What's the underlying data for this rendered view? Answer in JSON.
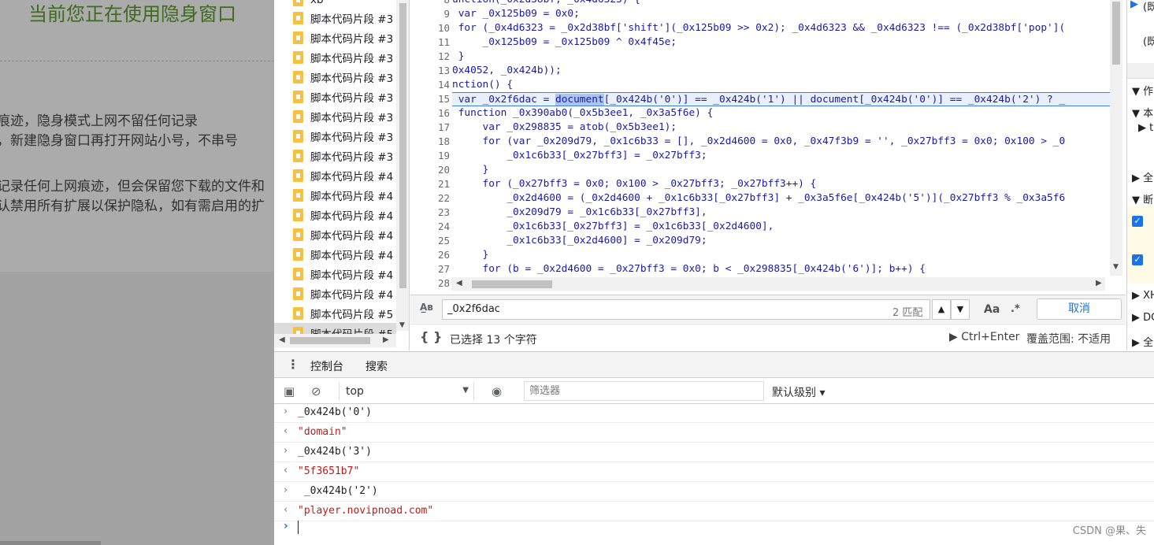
{
  "page": {
    "title": "当前您正在使用隐身窗口",
    "lines": [
      ":",
      "痕迹，隐身模式上网不留任何记录",
      "，新建隐身窗口再打开网站小号，不串号",
      "记录任何上网痕迹，但会保留您下载的文件和",
      "认禁用所有扩展以保护隐私，如有需启用的扩"
    ]
  },
  "navigator": {
    "top_label": "xb",
    "items": [
      "脚本代码片段 #3",
      "脚本代码片段 #3",
      "脚本代码片段 #3",
      "脚本代码片段 #3",
      "脚本代码片段 #3",
      "脚本代码片段 #3",
      "脚本代码片段 #3",
      "脚本代码片段 #3",
      "脚本代码片段 #4",
      "脚本代码片段 #4",
      "脚本代码片段 #4",
      "脚本代码片段 #4",
      "脚本代码片段 #4",
      "脚本代码片段 #4",
      "脚本代码片段 #4",
      "脚本代码片段 #5",
      "脚本代码片段 #5"
    ]
  },
  "editor": {
    "line_numbers": [
      "8",
      "9",
      "10",
      "11",
      "12",
      "13",
      "14",
      "15",
      "16",
      "17",
      "18",
      "19",
      "20",
      "21",
      "22",
      "23",
      "24",
      "25",
      "26",
      "27",
      "28"
    ],
    "lines": [
      "unction(_0x2d38bf, _0x4d6323) {",
      " var _0x125b09 = 0x0;",
      " for (_0x4d6323 = _0x2d38bf['shift'](_0x125b09 >> 0x2); _0x4d6323 && _0x4d6323 !== (_0x2d38bf['pop'](",
      "     _0x125b09 = _0x125b09 ^ 0x4f45e;",
      " }",
      "0x4052, _0x424b));",
      "nction() {",
      " var _0x2f6dac = ",
      " function _0x390ab0(_0x5b3ee1, _0x3a5f6e) {",
      "     var _0x298835 = atob(_0x5b3ee1);",
      "     for (var _0x209d79, _0x1c6b33 = [], _0x2d4600 = 0x0, _0x47f3b9 = '', _0x27bff3 = 0x0; 0x100 > _0",
      "         _0x1c6b33[_0x27bff3] = _0x27bff3;",
      "     }",
      "     for (_0x27bff3 = 0x0; 0x100 > _0x27bff3; _0x27bff3++) {",
      "         _0x2d4600 = (_0x2d4600 + _0x1c6b33[_0x27bff3] + _0x3a5f6e[_0x424b('5')](_0x27bff3 % _0x3a5f6",
      "         _0x209d79 = _0x1c6b33[_0x27bff3],",
      "         _0x1c6b33[_0x27bff3] = _0x1c6b33[_0x2d4600],",
      "         _0x1c6b33[_0x2d4600] = _0x209d79;",
      "     }",
      "     for (b = _0x2d4600 = _0x27bff3 = 0x0; b < _0x298835[_0x424b('6')]; b++) {",
      ""
    ],
    "highlight_selected": "document",
    "highlight_rest": "[_0x424b('0')] == _0x424b('1') || document[_0x424b('0')] == _0x424b('2') ? _"
  },
  "find": {
    "query": "_0x2f6dac",
    "count": "2 匹配",
    "aa_label": "Aa",
    "regex_label": ".*",
    "cancel_label": "取消"
  },
  "status": {
    "selection": "已选择 13 个字符",
    "run": "▶ Ctrl+Enter",
    "coverage": "覆盖范围: 不适用"
  },
  "right_panel": {
    "items": [
      "(既",
      "(既",
      "作",
      "本",
      "t",
      "全",
      "断",
      "XH",
      "DC",
      "全"
    ]
  },
  "drawer": {
    "tabs": [
      "控制台",
      "搜索"
    ],
    "context": "top",
    "filter_placeholder": "筛选器",
    "levels": "默认级别 ▾"
  },
  "console": {
    "entries": [
      {
        "type": "input",
        "text": "_0x424b('0')"
      },
      {
        "type": "output",
        "text": "\"domain\""
      },
      {
        "type": "input",
        "text": "_0x424b('3')"
      },
      {
        "type": "output",
        "text": "\"5f3651b7\""
      },
      {
        "type": "input",
        "text": " _0x424b('2')"
      },
      {
        "type": "output",
        "text": "\"player.novipnoad.com\""
      }
    ]
  },
  "watermark": "CSDN @果、失"
}
